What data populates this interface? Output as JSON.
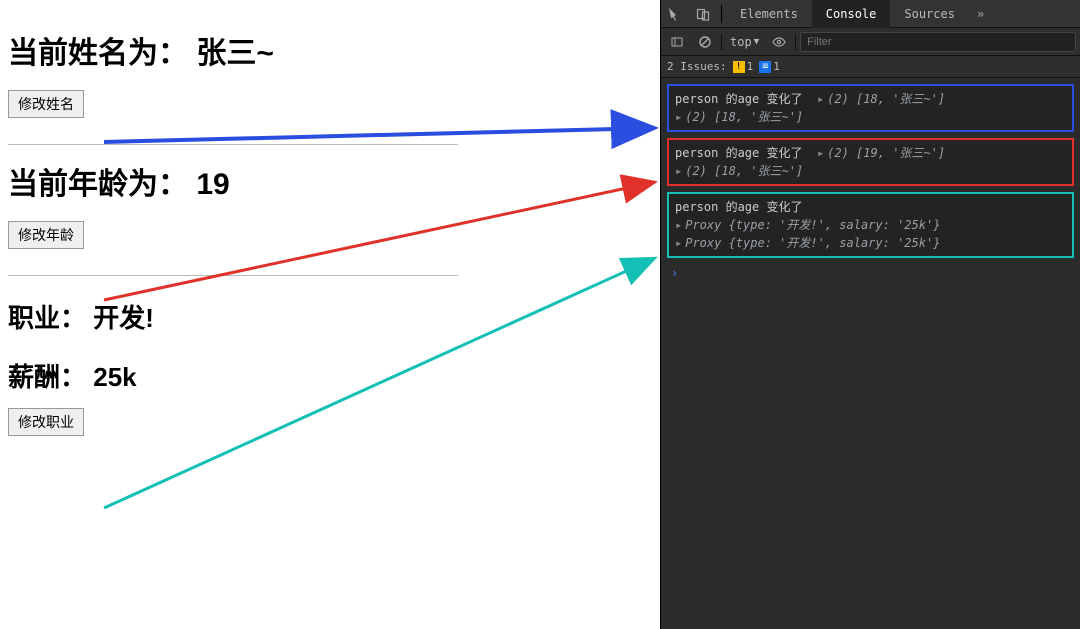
{
  "page": {
    "name_line": {
      "label": "当前姓名为：",
      "value": "张三~"
    },
    "age_line": {
      "label": "当前年龄为：",
      "value": "19"
    },
    "job_line": {
      "label": "职业：",
      "value": "开发!"
    },
    "salary_line": {
      "label": "薪酬：",
      "value": "25k"
    },
    "buttons": {
      "mod_name": "修改姓名",
      "mod_age": "修改年龄",
      "mod_job": "修改职业"
    }
  },
  "devtools": {
    "tabs": {
      "elements": "Elements",
      "console": "Console",
      "sources": "Sources"
    },
    "toolbar": {
      "context": "top",
      "filter_placeholder": "Filter"
    },
    "issues": {
      "label": "2 Issues:",
      "warn_count": "1",
      "info_count": "1"
    },
    "log_blue": {
      "msg": "person 的age 变化了",
      "arr1": "(2) [18, '张三~']",
      "arr2": "(2) [18, '张三~']"
    },
    "log_red": {
      "msg": "person 的age 变化了",
      "arr1": "(2) [19, '张三~']",
      "arr2": "(2) [18, '张三~']"
    },
    "log_teal": {
      "msg": "person 的age 变化了",
      "p1": "Proxy {type: '开发!', salary: '25k'}",
      "p2": "Proxy {type: '开发!', salary: '25k'}"
    }
  }
}
